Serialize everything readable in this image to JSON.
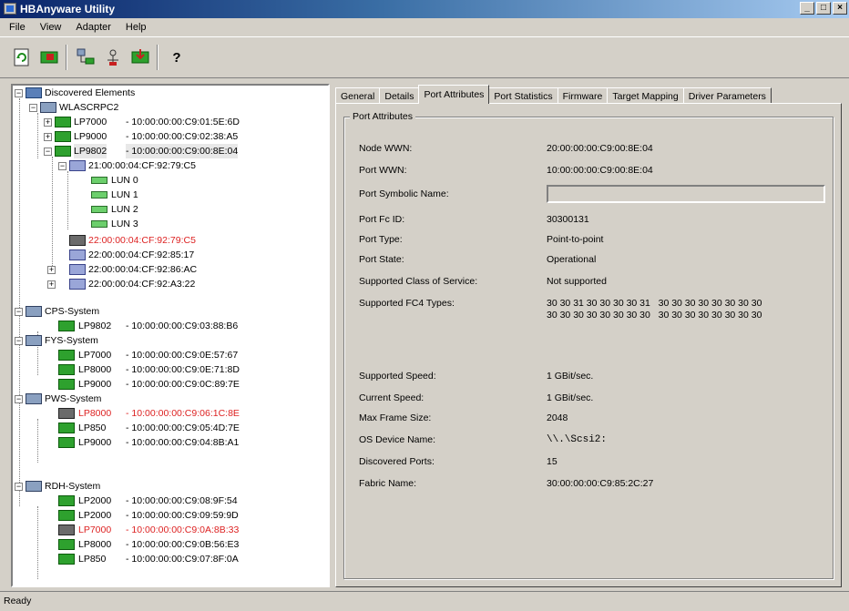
{
  "window": {
    "title": "HBAnyware Utility",
    "btn_min": "_",
    "btn_max": "□",
    "btn_close": "×"
  },
  "menu": [
    "File",
    "View",
    "Adapter",
    "Help"
  ],
  "toolbar": {
    "icons": [
      "discover-refresh-icon",
      "reset-adapter-icon",
      "sort-by-host-icon",
      "sort-by-fabric-icon",
      "download-firmware-icon",
      "help-icon"
    ],
    "help_glyph": "?"
  },
  "tree": {
    "root": "Discovered Elements",
    "host1": "WLASCRPC2",
    "nodes": [
      {
        "label": "LP7000",
        "wwn": "- 10:00:00:00:C9:01:5E:6D"
      },
      {
        "label": "LP9000",
        "wwn": "- 10:00:00:00:C9:02:38:A5"
      },
      {
        "label": "LP9802",
        "wwn": "- 10:00:00:00:C9:00:8E:04"
      },
      {
        "label": "21:00:00:04:CF:92:79:C5"
      },
      {
        "label": "LUN  0"
      },
      {
        "label": "LUN  1"
      },
      {
        "label": "LUN  2"
      },
      {
        "label": "LUN  3"
      },
      {
        "label": "22:00:00:04:CF:92:79:C5"
      },
      {
        "label": "22:00:00:04:CF:92:85:17"
      },
      {
        "label": "22:00:00:04:CF:92:86:AC"
      },
      {
        "label": "22:00:00:04:CF:92:A3:22"
      },
      {
        "label": "CPS-System"
      },
      {
        "label": "LP9802",
        "wwn": "- 10:00:00:00:C9:03:88:B6"
      },
      {
        "label": "FYS-System"
      },
      {
        "label": "LP7000",
        "wwn": "- 10:00:00:00:C9:0E:57:67"
      },
      {
        "label": "LP8000",
        "wwn": "- 10:00:00:00:C9:0E:71:8D"
      },
      {
        "label": "LP9000",
        "wwn": "- 10:00:00:00:C9:0C:89:7E"
      },
      {
        "label": "PWS-System"
      },
      {
        "label": "LP8000",
        "wwn": "- 10:00:00:00:C9:06:1C:8E"
      },
      {
        "label": "LP850",
        "wwn": "- 10:00:00:00:C9:05:4D:7E"
      },
      {
        "label": "LP9000",
        "wwn": "- 10:00:00:00:C9:04:8B:A1"
      },
      {
        "label": "RDH-System"
      },
      {
        "label": "LP2000",
        "wwn": "- 10:00:00:00:C9:08:9F:54"
      },
      {
        "label": "LP2000",
        "wwn": "- 10:00:00:00:C9:09:59:9D"
      },
      {
        "label": "LP7000",
        "wwn": "- 10:00:00:00:C9:0A:8B:33"
      },
      {
        "label": "LP8000",
        "wwn": "- 10:00:00:00:C9:0B:56:E3"
      },
      {
        "label": "LP850",
        "wwn": "- 10:00:00:00:C9:07:8F:0A"
      }
    ]
  },
  "tabs": [
    "General",
    "Details",
    "Port Attributes",
    "Port Statistics",
    "Firmware",
    "Target Mapping",
    "Driver Parameters"
  ],
  "active_tab": "Port Attributes",
  "group_title": "Port Attributes",
  "fields": {
    "node_wwn": {
      "label": "Node WWN:",
      "value": "20:00:00:00:C9:00:8E:04"
    },
    "port_wwn": {
      "label": "Port WWN:",
      "value": "10:00:00:00:C9:00:8E:04"
    },
    "port_symbolic_name": {
      "label": "Port Symbolic Name:",
      "value": ""
    },
    "port_fc_id": {
      "label": "Port Fc ID:",
      "value": "30300131"
    },
    "port_type": {
      "label": "Port Type:",
      "value": "Point-to-point"
    },
    "port_state": {
      "label": "Port State:",
      "value": "Operational"
    },
    "supported_class": {
      "label": "Supported Class of Service:",
      "value": "Not supported"
    },
    "supported_fc4": {
      "label": "Supported FC4 Types:",
      "value": "30 30 31 30 30 30 30 31   30 30 30 30 30 30 30 30\n30 30 30 30 30 30 30 30   30 30 30 30 30 30 30 30"
    },
    "supported_speed": {
      "label": "Supported Speed:",
      "value": "1 GBit/sec."
    },
    "current_speed": {
      "label": "Current Speed:",
      "value": "1 GBit/sec."
    },
    "max_frame_size": {
      "label": "Max Frame Size:",
      "value": "2048"
    },
    "os_device_name": {
      "label": "OS Device Name:",
      "value": "\\\\.\\Scsi2:"
    },
    "discovered_ports": {
      "label": "Discovered Ports:",
      "value": "15"
    },
    "fabric_name": {
      "label": "Fabric Name:",
      "value": "30:00:00:00:C9:85:2C:27"
    }
  },
  "status": {
    "text": "Ready"
  }
}
